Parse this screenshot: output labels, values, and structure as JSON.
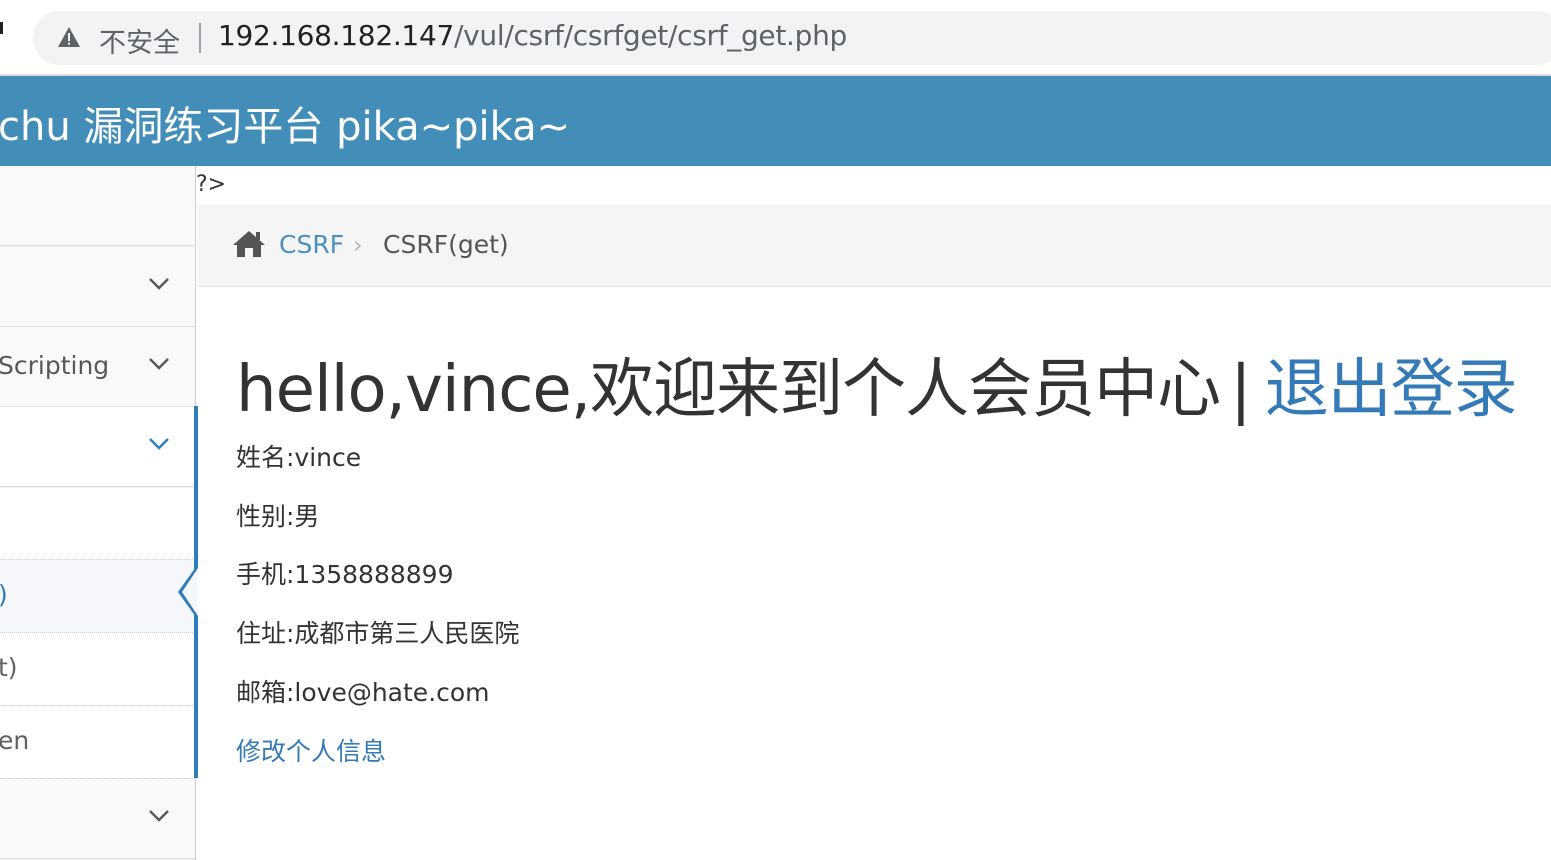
{
  "browser": {
    "security_label": "不安全",
    "url_host": "192.168.182.147",
    "url_path": "/vul/csrf/csrfget/csrf_get.php"
  },
  "header": {
    "title": "chu 漏洞练习平台 pika~pika~"
  },
  "sidebar": {
    "items": [
      {
        "label": ""
      },
      {
        "label": ""
      },
      {
        "label": "Scripting"
      },
      {
        "label": ""
      }
    ],
    "subitems": [
      {
        "label": ""
      },
      {
        "label": ")"
      },
      {
        "label": "t)"
      },
      {
        "label": "en"
      }
    ],
    "last_item": {
      "label": ""
    }
  },
  "stray_text": "?>",
  "breadcrumb": {
    "parent": "CSRF",
    "separator": "›",
    "current": "CSRF(get)"
  },
  "main": {
    "welcome": "hello,vince,欢迎来到个人会员中心",
    "divider": "|",
    "logout": "退出登录",
    "name": "姓名:vince",
    "gender": "性别:男",
    "phone": "手机:1358888899",
    "address": "住址:成都市第三人民医院",
    "email": "邮箱:love@hate.com",
    "edit_link": "修改个人信息"
  },
  "colors": {
    "header_bg": "#438eb9",
    "accent": "#2b7dbc",
    "link": "#337ab7"
  }
}
